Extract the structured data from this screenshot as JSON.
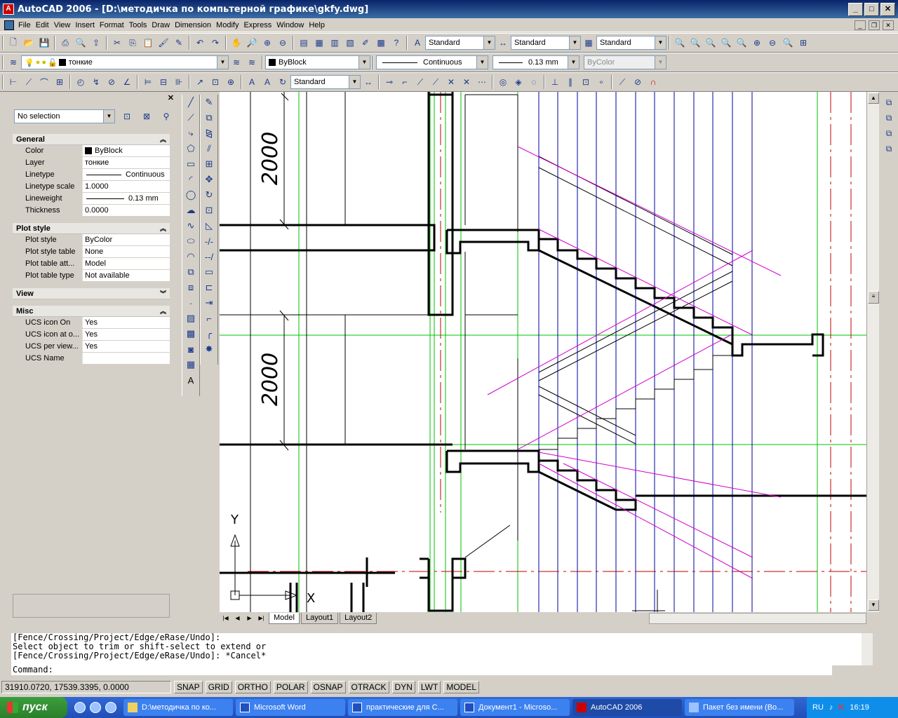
{
  "window": {
    "title": "AutoCAD 2006 - [D:\\методичка по компьтерной графике\\gkfy.dwg]",
    "app_icon_text": "A"
  },
  "menu": [
    "File",
    "Edit",
    "View",
    "Insert",
    "Format",
    "Tools",
    "Draw",
    "Dimension",
    "Modify",
    "Express",
    "Window",
    "Help"
  ],
  "toolbars": {
    "text_style": "Standard",
    "dim_style": "Standard",
    "table_style": "Standard",
    "layer": "тонкие",
    "color": "ByBlock",
    "linetype": "Continuous",
    "lineweight": "0.13 mm",
    "plotstyle": "ByColor",
    "dim_style2": "Standard"
  },
  "properties": {
    "selection": "No selection",
    "general": {
      "title": "General",
      "rows": [
        {
          "name": "Color",
          "value": "ByBlock"
        },
        {
          "name": "Layer",
          "value": "тонкие"
        },
        {
          "name": "Linetype",
          "value": "Continuous"
        },
        {
          "name": "Linetype scale",
          "value": "1.0000"
        },
        {
          "name": "Lineweight",
          "value": "0.13 mm"
        },
        {
          "name": "Thickness",
          "value": "0.0000"
        }
      ]
    },
    "plot_style": {
      "title": "Plot style",
      "rows": [
        {
          "name": "Plot style",
          "value": "ByColor"
        },
        {
          "name": "Plot style table",
          "value": "None"
        },
        {
          "name": "Plot table att...",
          "value": "Model"
        },
        {
          "name": "Plot table type",
          "value": "Not available"
        }
      ]
    },
    "view": {
      "title": "View"
    },
    "misc": {
      "title": "Misc",
      "rows": [
        {
          "name": "UCS icon On",
          "value": "Yes"
        },
        {
          "name": "UCS icon at o...",
          "value": "Yes"
        },
        {
          "name": "UCS per view...",
          "value": "Yes"
        },
        {
          "name": "UCS Name",
          "value": ""
        }
      ]
    }
  },
  "drawing": {
    "dim_top": "2000",
    "dim_bottom": "2000",
    "ucs_y": "Y",
    "ucs_x": "X"
  },
  "layout_tabs": [
    "Model",
    "Layout1",
    "Layout2"
  ],
  "command": {
    "lines": [
      "[Fence/Crossing/Project/Edge/eRase/Undo]:",
      "Select object to trim or shift-select to extend or",
      "[Fence/Crossing/Project/Edge/eRase/Undo]: *Cancel*"
    ],
    "prompt": "Command:"
  },
  "status": {
    "coords": "31910.0720, 17539.3395, 0.0000",
    "buttons": [
      "SNAP",
      "GRID",
      "ORTHO",
      "POLAR",
      "OSNAP",
      "OTRACK",
      "DYN",
      "LWT",
      "MODEL"
    ]
  },
  "taskbar": {
    "start": "пуск",
    "tasks": [
      {
        "label": "D:\\методичка по ко..."
      },
      {
        "label": "Microsoft Word"
      },
      {
        "label": "практические для С..."
      },
      {
        "label": "Документ1 - Microso..."
      },
      {
        "label": "AutoCAD 2006"
      },
      {
        "label": "Пакет без имени (Во..."
      }
    ],
    "lang": "RU",
    "time": "16:19"
  },
  "colors": {
    "grid_green": "#00c000",
    "blue_lines": "#0000a0",
    "magenta": "#d000d0",
    "red_dash": "#c00000"
  }
}
